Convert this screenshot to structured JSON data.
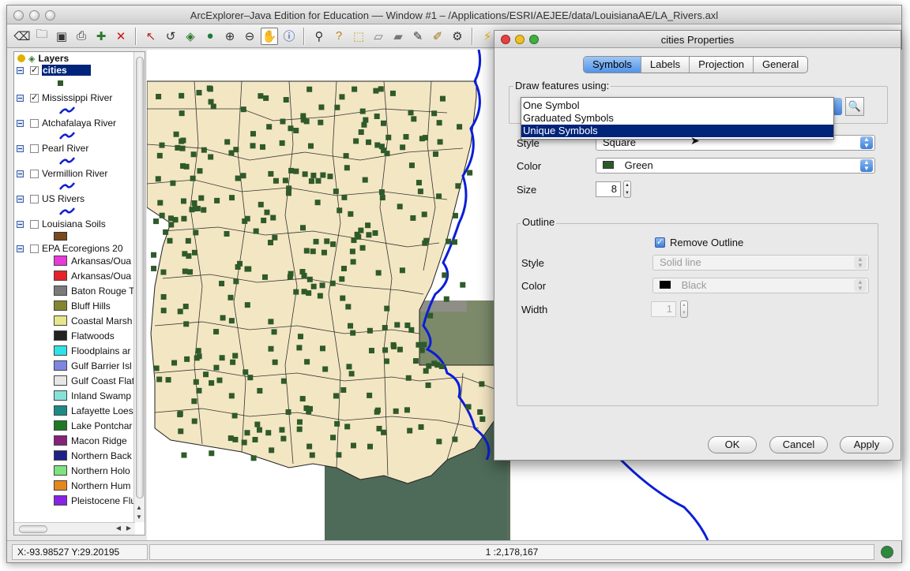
{
  "window": {
    "title": "ArcExplorer–Java Edition for Education –– Window #1 – /Applications/ESRI/AEJEE/data/LouisianaAE/LA_Rivers.axl"
  },
  "toolbar": {
    "icons": [
      "eraser-icon",
      "open-folder-icon",
      "save-icon",
      "print-icon",
      "add-layer-icon",
      "remove-layer-icon",
      "zoom-extent-icon",
      "zoom-previous-icon",
      "zoom-layer-icon",
      "globe-icon",
      "zoom-in-icon",
      "zoom-out-icon",
      "pan-hand-icon",
      "identify-icon",
      "binoculars-icon",
      "query-icon",
      "select-icon",
      "clear-selection-icon",
      "measure-icon",
      "buffer-icon",
      "hotlink-icon",
      "lightning-icon"
    ]
  },
  "layers": {
    "header": "Layers",
    "items": [
      {
        "label": "cities",
        "checked": true,
        "selected": true
      },
      {
        "label": "Mississippi River",
        "checked": true
      },
      {
        "label": "Atchafalaya River",
        "checked": false
      },
      {
        "label": "Pearl River",
        "checked": false
      },
      {
        "label": "Vermillion River",
        "checked": false
      },
      {
        "label": "US Rivers",
        "checked": false
      },
      {
        "label": "Louisiana Soils",
        "checked": false
      },
      {
        "label": "EPA Ecoregions 20",
        "checked": false
      }
    ],
    "ecoregions": [
      {
        "label": "Arkansas/Oua",
        "color": "#e83ad8"
      },
      {
        "label": "Arkansas/Oua",
        "color": "#e8202a"
      },
      {
        "label": "Baton Rouge T",
        "color": "#7a7a7a"
      },
      {
        "label": "Bluff Hills",
        "color": "#848431"
      },
      {
        "label": "Coastal Marsh",
        "color": "#e6e68a"
      },
      {
        "label": "Flatwoods",
        "color": "#222222"
      },
      {
        "label": "Floodplains ar",
        "color": "#2ee2e6"
      },
      {
        "label": "Gulf Barrier Isl",
        "color": "#7e86e2"
      },
      {
        "label": "Gulf Coast Flat",
        "color": "#e6e6e6"
      },
      {
        "label": "Inland Swamp",
        "color": "#86e2d8"
      },
      {
        "label": "Lafayette Loes",
        "color": "#1e8a86"
      },
      {
        "label": "Lake Pontchar",
        "color": "#1e7a22"
      },
      {
        "label": "Macon Ridge",
        "color": "#86227a"
      },
      {
        "label": "Northern Back",
        "color": "#1e2286"
      },
      {
        "label": "Northern Holo",
        "color": "#7ee27e"
      },
      {
        "label": "Northern Hum",
        "color": "#e6861e"
      },
      {
        "label": "Pleistocene Flu",
        "color": "#8a22e6"
      }
    ],
    "soil_color": "#7a4a1e",
    "city_color": "#2f5a2a"
  },
  "status": {
    "coords": "X:-93.98527 Y:29.20195",
    "scale": "1 :2,178,167"
  },
  "dialog": {
    "title": "cities Properties",
    "tabs": [
      "Symbols",
      "Labels",
      "Projection",
      "General"
    ],
    "active_tab": "Symbols",
    "draw_features_label": "Draw features using:",
    "draw_options": [
      "One Symbol",
      "Graduated Symbols",
      "Unique Symbols"
    ],
    "selected_draw_option": "Unique Symbols",
    "style_label": "Style",
    "style_value": "Square",
    "color_label": "Color",
    "color_value": "Green",
    "color_swatch": "#2a5a2a",
    "size_label": "Size",
    "size_value": "8",
    "outline": {
      "label": "Outline",
      "remove_label": "Remove Outline",
      "remove_checked": true,
      "style_label": "Style",
      "style_value": "Solid line",
      "color_label": "Color",
      "color_value": "Black",
      "width_label": "Width",
      "width_value": "1"
    },
    "buttons": {
      "ok": "OK",
      "cancel": "Cancel",
      "apply": "Apply"
    }
  }
}
